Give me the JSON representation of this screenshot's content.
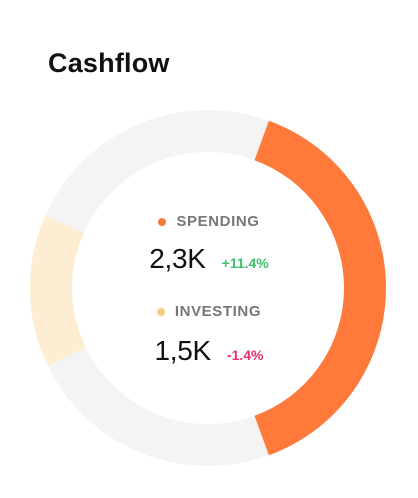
{
  "widget": {
    "title": "Cashflow"
  },
  "donut": {
    "ring_bg_color": "#F4F4F4",
    "segments": [
      {
        "name": "spending",
        "start_deg": 20,
        "end_deg": 160,
        "color": "#FF7A3A"
      },
      {
        "name": "investing",
        "start_deg": 244,
        "end_deg": 294,
        "color": "#FCEDD3"
      }
    ]
  },
  "metrics": {
    "spending": {
      "label": "SPENDING",
      "dot_color": "#F5783E",
      "value": "2,3K",
      "delta": "+11.4%",
      "delta_color": "#3FBF6A"
    },
    "investing": {
      "label": "INVESTING",
      "dot_color": "#F3CE7E",
      "value": "1,5K",
      "delta": "-1.4%",
      "delta_color": "#E8336B"
    }
  }
}
